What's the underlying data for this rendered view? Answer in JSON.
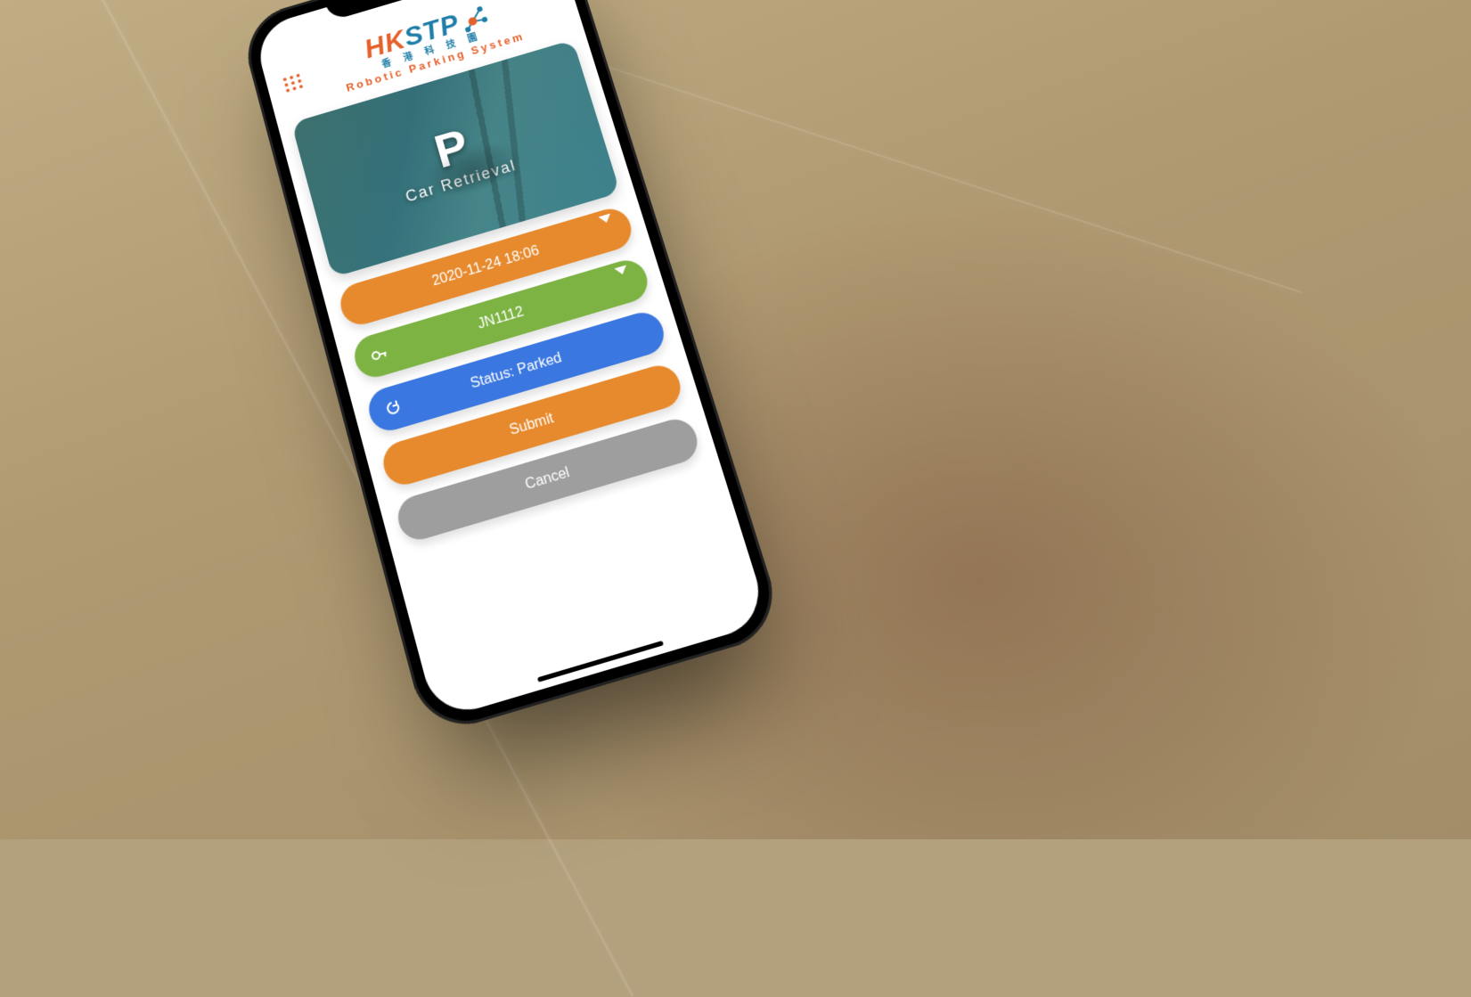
{
  "logo": {
    "hk": "HK",
    "stp": "STP",
    "sub_cn": "香 港 科 技 園",
    "sub_en": "Robotic Parking System"
  },
  "hero": {
    "p": "P",
    "caption": "Car Retrieval"
  },
  "rows": {
    "datetime": "2020-11-24 18:06",
    "plate": "JN1112",
    "status": "Status: Parked",
    "submit": "Submit",
    "cancel": "Cancel"
  }
}
